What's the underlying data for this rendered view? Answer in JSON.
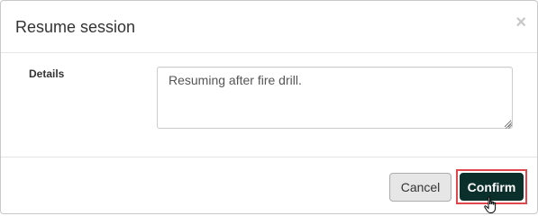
{
  "dialog": {
    "title": "Resume session",
    "close_glyph": "×",
    "close_icon": "close-icon"
  },
  "form": {
    "details_label": "Details",
    "details_value": "Resuming after fire drill."
  },
  "footer": {
    "cancel_label": "Cancel",
    "confirm_label": "Confirm"
  },
  "colors": {
    "confirm_bg": "#0b2f2a",
    "highlight_border": "#e0474c",
    "cancel_bg": "#e6e6e6"
  }
}
